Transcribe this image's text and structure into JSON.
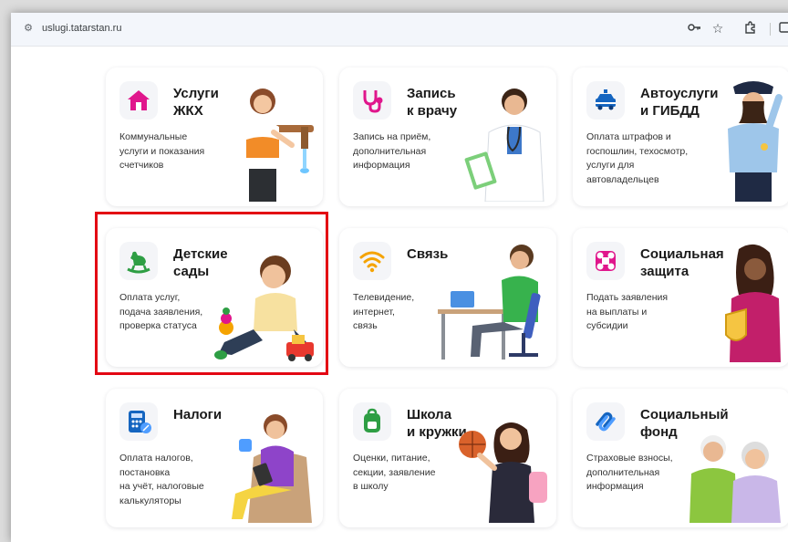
{
  "browser": {
    "url": "uslugi.tatarstan.ru",
    "icons": [
      "tune-icon",
      "key-icon",
      "star-icon",
      "extensions-icon",
      "sidepanel-icon"
    ]
  },
  "cards": [
    {
      "title": "Услуги\nЖКХ",
      "desc": "Коммунальные\nуслуги и показания\nсчетчиков",
      "icon": "house-icon",
      "illustration": "woman-faucet-illustration"
    },
    {
      "title": "Запись\nк врачу",
      "desc": "Запись на приём,\nдополнительная\nинформация",
      "icon": "stethoscope-icon",
      "illustration": "doctor-illustration"
    },
    {
      "title": "Автоуслуги\nи ГИБДД",
      "desc": "Оплата штрафов и\nгоспошлин, техосмотр,\nуслуги для\nавтовладельцев",
      "icon": "police-car-icon",
      "illustration": "police-officer-illustration"
    },
    {
      "title": "Детские\nсады",
      "desc": "Оплата услуг,\nподача заявления,\nпроверка статуса",
      "icon": "rocking-horse-icon",
      "illustration": "child-toys-illustration"
    },
    {
      "title": "Связь",
      "desc": "Телевидение,\nинтернет,\nсвязь",
      "icon": "wifi-icon",
      "illustration": "man-desk-phone-illustration"
    },
    {
      "title": "Социальная\nзащита",
      "desc": "Подать заявления\nна выплаты и\nсубсидии",
      "icon": "social-protection-icon",
      "illustration": "woman-shield-illustration"
    },
    {
      "title": "Налоги",
      "desc": "Оплата налогов,\nпостановка\nна учёт, налоговые\nкалькуляторы",
      "icon": "calculator-icon",
      "illustration": "man-armchair-tablet-illustration"
    },
    {
      "title": "Школа\nи кружки",
      "desc": "Оценки, питание,\nсекции, заявление\nв школу",
      "icon": "backpack-icon",
      "illustration": "schoolgirl-ball-illustration"
    },
    {
      "title": "Социальный\nфонд",
      "desc": "Страховые взносы,\nдополнительная\nинформация",
      "icon": "social-fund-icon",
      "illustration": "elderly-couple-illustration"
    }
  ],
  "colors": {
    "highlight": "#e30613",
    "accent_pink": "#e0168c",
    "accent_blue": "#1565c0",
    "accent_green": "#2e9e44",
    "accent_orange": "#f5a300"
  }
}
